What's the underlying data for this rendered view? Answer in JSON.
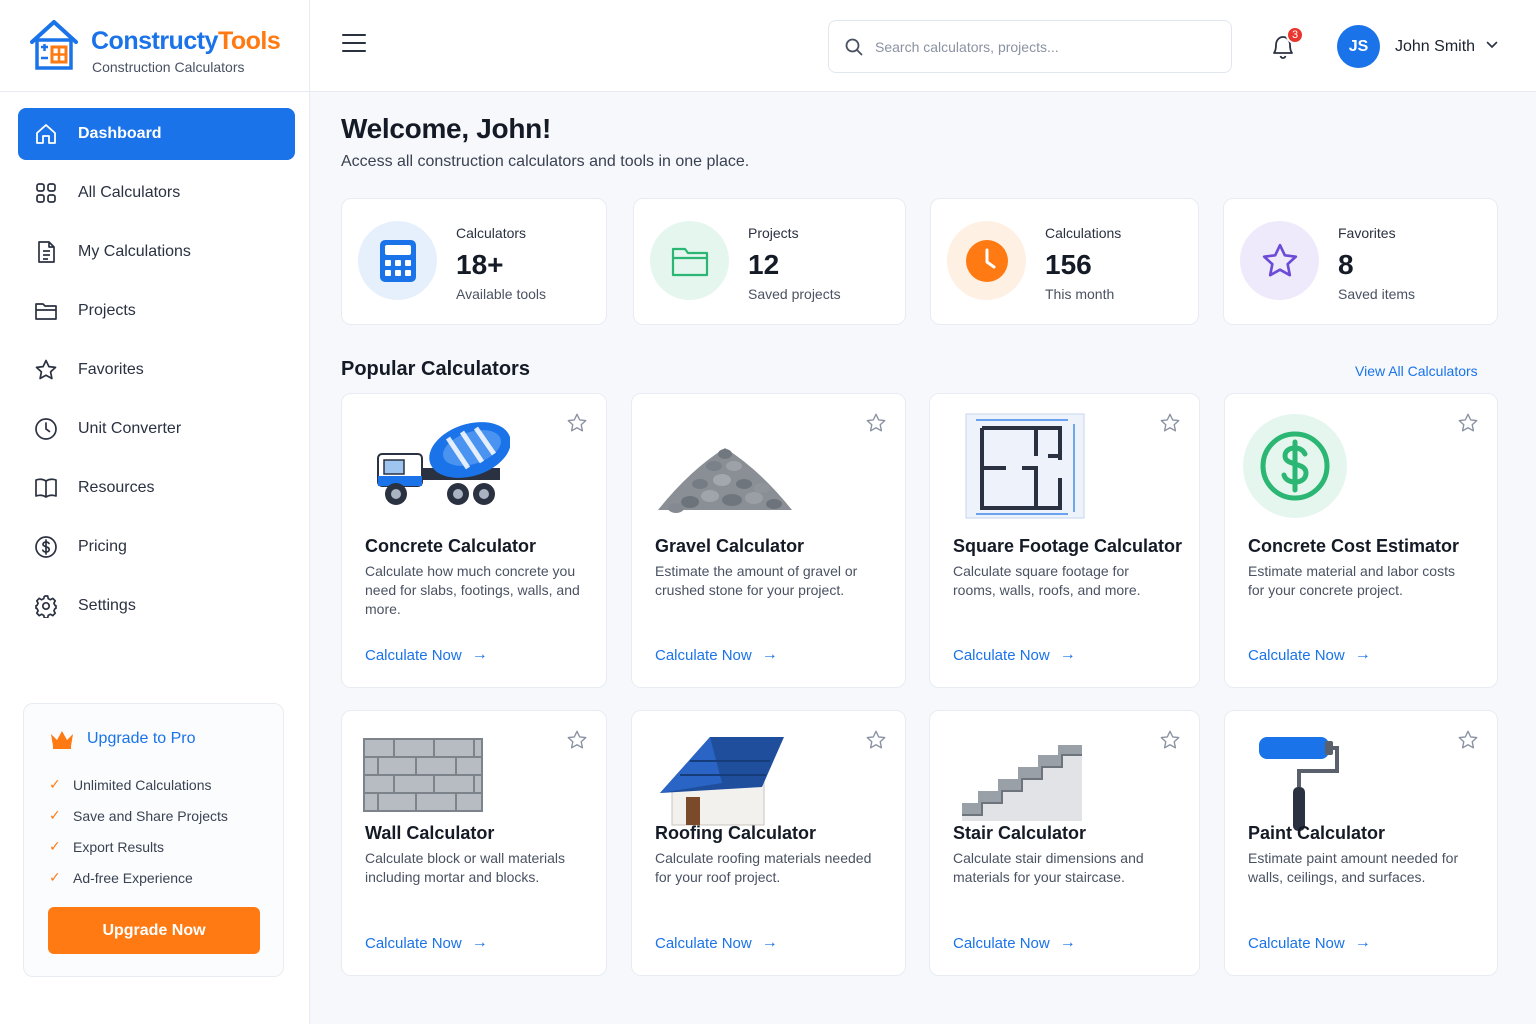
{
  "brand": {
    "name_part1": "Constructy",
    "name_part2": "Tools",
    "subtitle": "Construction Calculators"
  },
  "sidebar": {
    "items": [
      {
        "label": "Dashboard",
        "icon": "home-icon",
        "active": true
      },
      {
        "label": "All Calculators",
        "icon": "grid-icon"
      },
      {
        "label": "My Calculations",
        "icon": "document-icon"
      },
      {
        "label": "Projects",
        "icon": "folder-icon"
      },
      {
        "label": "Favorites",
        "icon": "star-icon"
      },
      {
        "label": "Unit Converter",
        "icon": "clock-icon"
      },
      {
        "label": "Resources",
        "icon": "book-icon"
      },
      {
        "label": "Pricing",
        "icon": "dollar-icon"
      },
      {
        "label": "Settings",
        "icon": "gear-icon"
      }
    ],
    "upgrade": {
      "title": "Upgrade to Pro",
      "features": [
        "Unlimited Calculations",
        "Save and Share Projects",
        "Export Results",
        "Ad-free Experience"
      ],
      "button": "Upgrade Now"
    }
  },
  "header": {
    "search_placeholder": "Search calculators, projects...",
    "notification_count": "3",
    "user_initials": "JS",
    "user_name": "John Smith"
  },
  "main": {
    "welcome": "Welcome, John!",
    "welcome_sub": "Access all construction calculators and tools in one place.",
    "stats": [
      {
        "label": "Calculators",
        "value": "18+",
        "sub": "Available tools",
        "icon": "calculator-icon",
        "color": "#1a73e8"
      },
      {
        "label": "Projects",
        "value": "12",
        "sub": "Saved projects",
        "icon": "folder-icon",
        "color": "#2bb673"
      },
      {
        "label": "Calculations",
        "value": "156",
        "sub": "This month",
        "icon": "clock-icon",
        "color": "#ff7a12"
      },
      {
        "label": "Favorites",
        "value": "8",
        "sub": "Saved items",
        "icon": "star-icon",
        "color": "#6c4cd6"
      }
    ],
    "popular_title": "Popular Calculators",
    "view_all": "View All Calculators",
    "calculators": [
      {
        "title": "Concrete Calculator",
        "desc": "Calculate how much concrete you need for slabs, footings, walls, and more.",
        "link": "Calculate Now",
        "image": "concrete-mixer-truck"
      },
      {
        "title": "Gravel Calculator",
        "desc": "Estimate the amount of gravel or crushed stone for your project.",
        "link": "Calculate Now",
        "image": "gravel-pile"
      },
      {
        "title": "Square Footage Calculator",
        "desc": "Calculate square footage for rooms, walls, roofs, and more.",
        "link": "Calculate Now",
        "image": "floor-plan"
      },
      {
        "title": "Concrete Cost Estimator",
        "desc": "Estimate material and labor costs for your concrete project.",
        "link": "Calculate Now",
        "image": "dollar-badge"
      },
      {
        "title": "Wall Calculator",
        "desc": "Calculate block or wall materials including mortar and blocks.",
        "link": "Calculate Now",
        "image": "block-wall"
      },
      {
        "title": "Roofing Calculator",
        "desc": "Calculate roofing materials needed for your roof project.",
        "link": "Calculate Now",
        "image": "house-roof"
      },
      {
        "title": "Stair Calculator",
        "desc": "Calculate stair dimensions and materials for your staircase.",
        "link": "Calculate Now",
        "image": "stairs"
      },
      {
        "title": "Paint Calculator",
        "desc": "Estimate paint amount needed for walls, ceilings, and surfaces.",
        "link": "Calculate Now",
        "image": "paint-roller"
      }
    ]
  }
}
